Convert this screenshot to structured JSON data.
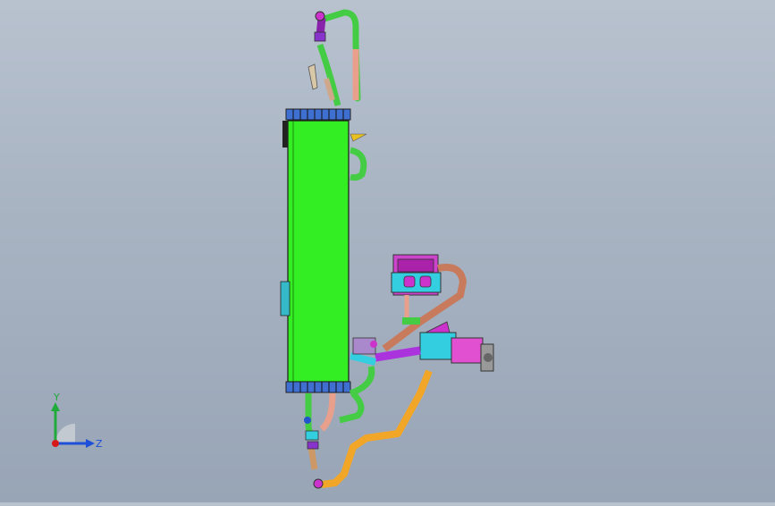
{
  "viewport": {
    "background_top": "#b8c2cf",
    "background_bottom": "#98a5b6"
  },
  "triad": {
    "y_label": "Y",
    "z_label": "Z",
    "y_color": "#1faa3a",
    "z_color": "#1d4fd8",
    "origin_color": "#d61a1a"
  },
  "colors": {
    "radiator_core": "#33ee22",
    "tank": "#3f6fd0",
    "green_hose": "#44cc44",
    "pink_hose": "#e8a08c",
    "orange_hose": "#f2a628",
    "magenta": "#cc33cc",
    "cyan": "#33cfe0",
    "copper": "#c87a5c"
  }
}
